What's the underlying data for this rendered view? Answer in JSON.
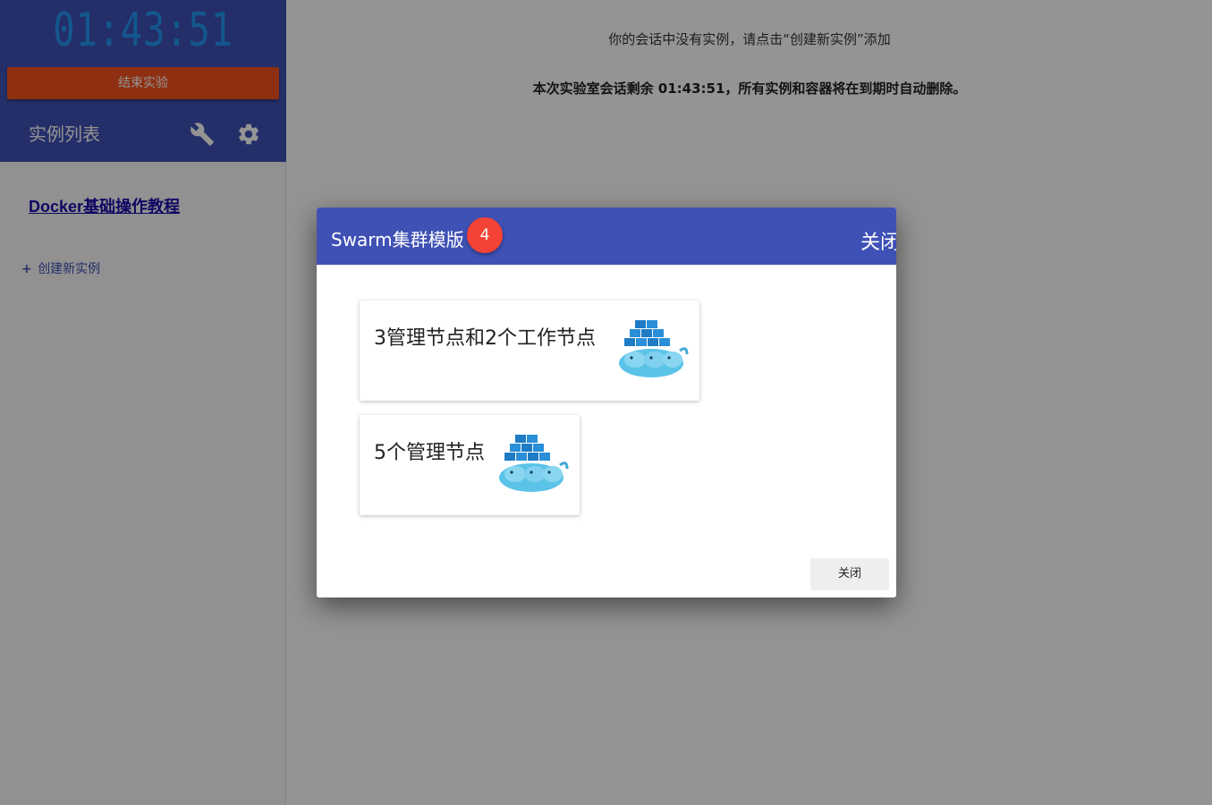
{
  "sidebar": {
    "timer": "01:43:51",
    "end_button_label": "结束实验",
    "instances_title": "实例列表",
    "tutorial_link": "Docker基础操作教程",
    "create_instance_plus": "+",
    "create_instance_label": "创建新实例"
  },
  "main": {
    "message": "你的会话中没有实例，请点击“创建新实例”添加",
    "warning": "本次实验室会话剩余 01:43:51，所有实例和容器将在到期时自动删除。"
  },
  "dialog": {
    "title": "Swarm集群模版",
    "badge": "4",
    "header_close": "关闭",
    "templates": [
      {
        "label": "3管理节点和2个工作节点"
      },
      {
        "label": "5个管理节点"
      }
    ],
    "close_button": "关闭"
  },
  "colors": {
    "primary": "#3f51b5",
    "accent": "#f4511e",
    "timer": "#2196f3",
    "badge": "#f44336",
    "link": "#1a0dab"
  },
  "icons": {
    "settings_tool": "wrench-icon",
    "settings": "gear-icon",
    "template": "docker-whale-icon"
  }
}
